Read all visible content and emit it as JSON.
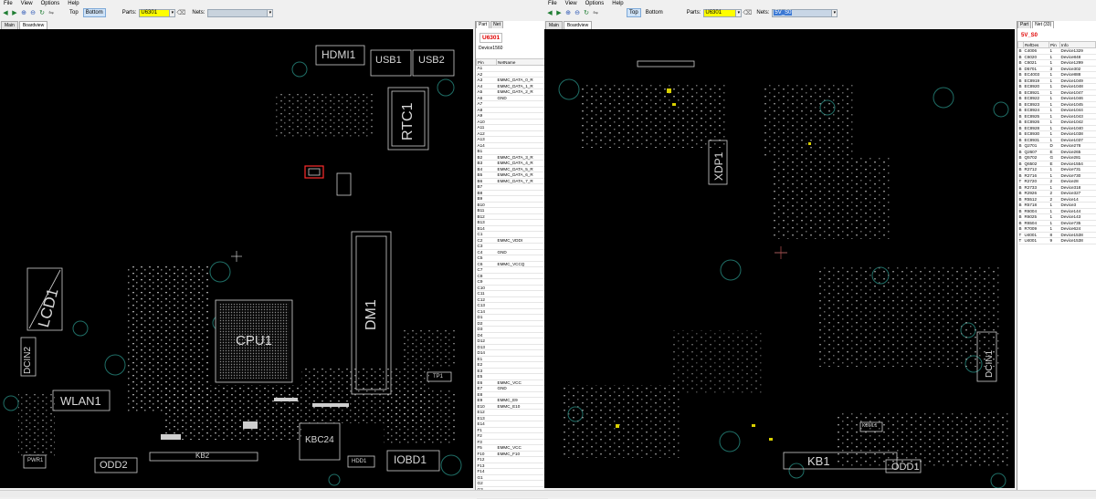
{
  "left": {
    "menu": [
      "File",
      "View",
      "Options",
      "Help"
    ],
    "toolbar": {
      "top_label": "Top",
      "bottom_label": "Bottom",
      "active_side": "bottom",
      "parts_label": "Parts:",
      "parts_value": "U6301",
      "nets_label": "Nets:",
      "nets_value": ""
    },
    "tabs": [
      "Main",
      "Boardview"
    ],
    "active_tab": "Boardview",
    "board_labels": {
      "hdmi": "HDMI1",
      "usb1": "USB1",
      "usb2": "USB2",
      "rtc": "RTC1",
      "lcd": "LCD1",
      "cpu": "CPU1",
      "dm": "DM1",
      "dcin": "DCIN2",
      "wlan": "WLAN1",
      "tp": "TP1",
      "kbc": "KBC24",
      "hdd": "HDD1",
      "iobd": "IOBD1",
      "kb": "KB2",
      "odd": "ODD2",
      "pwr": "PWR1"
    },
    "panel": {
      "tabs": [
        "Part",
        "Net"
      ],
      "active_tab": "Part",
      "part_name": "U6301",
      "part_desc": "Device1560",
      "headers": [
        "Pin",
        "NetName"
      ],
      "rows": [
        [
          "A1",
          ""
        ],
        [
          "A2",
          ""
        ],
        [
          "A3",
          "EMMC_DATA_0_R"
        ],
        [
          "A4",
          "EMMC_DATA_1_R"
        ],
        [
          "A5",
          "EMMC_DATA_2_R"
        ],
        [
          "A6",
          "GND"
        ],
        [
          "A7",
          ""
        ],
        [
          "A8",
          ""
        ],
        [
          "A9",
          ""
        ],
        [
          "A10",
          ""
        ],
        [
          "A11",
          ""
        ],
        [
          "A12",
          ""
        ],
        [
          "A13",
          ""
        ],
        [
          "A14",
          ""
        ],
        [
          "B1",
          ""
        ],
        [
          "B2",
          "EMMC_DATA_3_R"
        ],
        [
          "B3",
          "EMMC_DATA_4_R"
        ],
        [
          "B4",
          "EMMC_DATA_5_R"
        ],
        [
          "B5",
          "EMMC_DATA_6_R"
        ],
        [
          "B6",
          "EMMC_DATA_7_R"
        ],
        [
          "B7",
          ""
        ],
        [
          "B8",
          ""
        ],
        [
          "B9",
          ""
        ],
        [
          "B10",
          ""
        ],
        [
          "B11",
          ""
        ],
        [
          "B12",
          ""
        ],
        [
          "B13",
          ""
        ],
        [
          "B14",
          ""
        ],
        [
          "C1",
          ""
        ],
        [
          "C2",
          "EMMC_VDDI"
        ],
        [
          "C3",
          ""
        ],
        [
          "C4",
          "GND"
        ],
        [
          "C5",
          ""
        ],
        [
          "C6",
          "EMMC_VCCQ"
        ],
        [
          "C7",
          ""
        ],
        [
          "C8",
          ""
        ],
        [
          "C9",
          ""
        ],
        [
          "C10",
          ""
        ],
        [
          "C11",
          ""
        ],
        [
          "C12",
          ""
        ],
        [
          "C13",
          ""
        ],
        [
          "C14",
          ""
        ],
        [
          "D1",
          ""
        ],
        [
          "D2",
          ""
        ],
        [
          "D3",
          ""
        ],
        [
          "D4",
          ""
        ],
        [
          "D12",
          ""
        ],
        [
          "D13",
          ""
        ],
        [
          "D14",
          ""
        ],
        [
          "E1",
          ""
        ],
        [
          "E2",
          ""
        ],
        [
          "E3",
          ""
        ],
        [
          "E5",
          ""
        ],
        [
          "E6",
          "EMMC_VCC"
        ],
        [
          "E7",
          "GND"
        ],
        [
          "E8",
          ""
        ],
        [
          "E9",
          "EMMC_E9"
        ],
        [
          "E10",
          "EMMC_E10"
        ],
        [
          "E12",
          ""
        ],
        [
          "E13",
          ""
        ],
        [
          "E14",
          ""
        ],
        [
          "F1",
          ""
        ],
        [
          "F2",
          ""
        ],
        [
          "F3",
          ""
        ],
        [
          "F5",
          "EMMC_VCC"
        ],
        [
          "F10",
          "EMMC_F10"
        ],
        [
          "F12",
          ""
        ],
        [
          "F13",
          ""
        ],
        [
          "F14",
          ""
        ],
        [
          "G1",
          ""
        ],
        [
          "G2",
          ""
        ],
        [
          "G3",
          ""
        ],
        [
          "G5",
          "GND"
        ]
      ]
    }
  },
  "right": {
    "menu": [
      "File",
      "View",
      "Options",
      "Help"
    ],
    "toolbar": {
      "top_label": "Top",
      "bottom_label": "Bottom",
      "active_side": "top",
      "parts_label": "Parts:",
      "parts_value": "U6301",
      "nets_label": "Nets:",
      "nets_value": "5V_S0"
    },
    "tabs": [
      "Main",
      "Boardview"
    ],
    "active_tab": "Boardview",
    "board_labels": {
      "xdp": "XDP1",
      "dcin": "DCIN1",
      "kb": "KB1",
      "odd": "ODD1",
      "kbml": "KBML1"
    },
    "panel": {
      "tabs": [
        "Part",
        "Net (33)"
      ],
      "active_tab": "Net (33)",
      "net_name": "5V_S0",
      "headers": [
        "",
        "RefDes",
        "Pin",
        "Info"
      ],
      "rows": [
        [
          "B",
          "C4006",
          "1",
          "Device1329"
        ],
        [
          "B",
          "C6020",
          "1",
          "Device848"
        ],
        [
          "B",
          "C6021",
          "1",
          "Device1299"
        ],
        [
          "B",
          "D5701",
          "3",
          "Device302"
        ],
        [
          "B",
          "EC4003",
          "1",
          "Device888"
        ],
        [
          "B",
          "EC8919",
          "1",
          "Device1049"
        ],
        [
          "B",
          "EC8920",
          "1",
          "Device1048"
        ],
        [
          "B",
          "EC8921",
          "1",
          "Device1047"
        ],
        [
          "B",
          "EC8922",
          "1",
          "Device1046"
        ],
        [
          "B",
          "EC8923",
          "1",
          "Device1045"
        ],
        [
          "B",
          "EC8924",
          "1",
          "Device1044"
        ],
        [
          "B",
          "EC8925",
          "1",
          "Device1043"
        ],
        [
          "B",
          "EC8926",
          "1",
          "Device1042"
        ],
        [
          "B",
          "EC8928",
          "1",
          "Device1040"
        ],
        [
          "B",
          "EC8930",
          "1",
          "Device1038"
        ],
        [
          "B",
          "EC8931",
          "1",
          "Device1037"
        ],
        [
          "B",
          "Q2701",
          "D",
          "Device278"
        ],
        [
          "B",
          "Q2607",
          "E",
          "Device265"
        ],
        [
          "B",
          "Q5702",
          "G",
          "Device281"
        ],
        [
          "B",
          "Q6502",
          "E",
          "Device1554"
        ],
        [
          "B",
          "R2712",
          "1",
          "Device731"
        ],
        [
          "B",
          "R2716",
          "1",
          "Device730"
        ],
        [
          "T",
          "R2720",
          "2",
          "Device28"
        ],
        [
          "B",
          "R2733",
          "1",
          "Device318"
        ],
        [
          "B",
          "R2926",
          "2",
          "Device327"
        ],
        [
          "B",
          "R5512",
          "2",
          "Device14"
        ],
        [
          "B",
          "R5718",
          "1",
          "Device3"
        ],
        [
          "B",
          "R6004",
          "1",
          "Device144"
        ],
        [
          "B",
          "R6025",
          "1",
          "Device143"
        ],
        [
          "B",
          "R6504",
          "1",
          "Device735"
        ],
        [
          "B",
          "R7009",
          "1",
          "Device624"
        ],
        [
          "T",
          "U4001",
          "8",
          "Device1538"
        ],
        [
          "T",
          "U4001",
          "9",
          "Device1538"
        ]
      ]
    }
  }
}
